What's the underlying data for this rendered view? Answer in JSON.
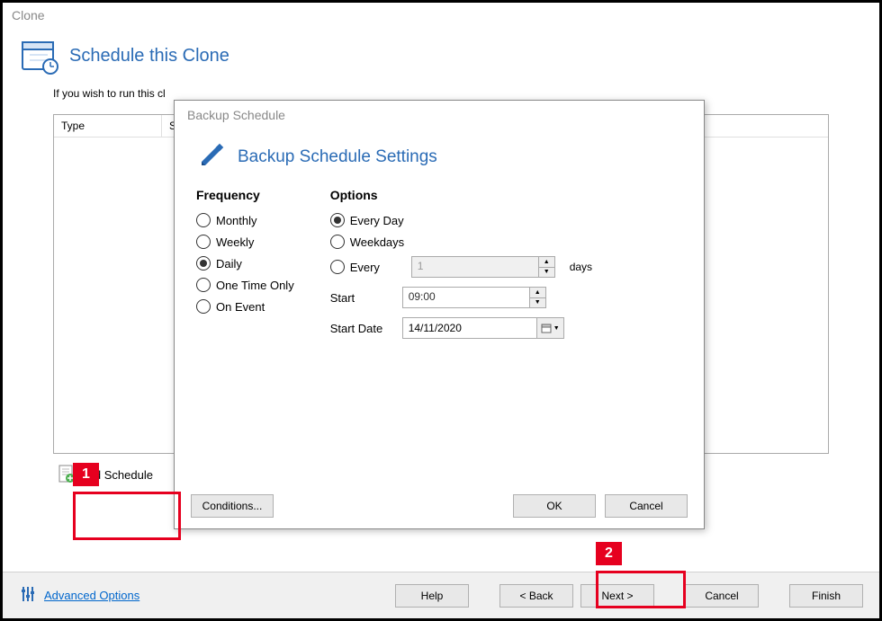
{
  "window": {
    "title": "Clone"
  },
  "page": {
    "title": "Schedule this Clone",
    "description": "If you wish to run this cl",
    "table": {
      "col_type": "Type",
      "col_s": "S"
    },
    "add_schedule": "Add Schedule"
  },
  "bottombar": {
    "advanced": "Advanced Options",
    "help": "Help",
    "back": "<  Back",
    "next": "Next  >",
    "cancel": "Cancel",
    "finish": "Finish"
  },
  "dialog": {
    "title": "Backup Schedule",
    "header": "Backup Schedule Settings",
    "frequency": {
      "heading": "Frequency",
      "monthly": "Monthly",
      "weekly": "Weekly",
      "daily": "Daily",
      "onetime": "One Time Only",
      "onevent": "On Event",
      "selected": "daily"
    },
    "options": {
      "heading": "Options",
      "everyday": "Every Day",
      "weekdays": "Weekdays",
      "every": "Every",
      "selected": "everyday",
      "every_n_value": "1",
      "every_n_suffix": "days",
      "start_label": "Start",
      "start_value": "09:00",
      "startdate_label": "Start Date",
      "startdate_value": "14/11/2020"
    },
    "buttons": {
      "conditions": "Conditions...",
      "ok": "OK",
      "cancel": "Cancel"
    }
  },
  "callouts": {
    "one": "1",
    "two": "2"
  }
}
